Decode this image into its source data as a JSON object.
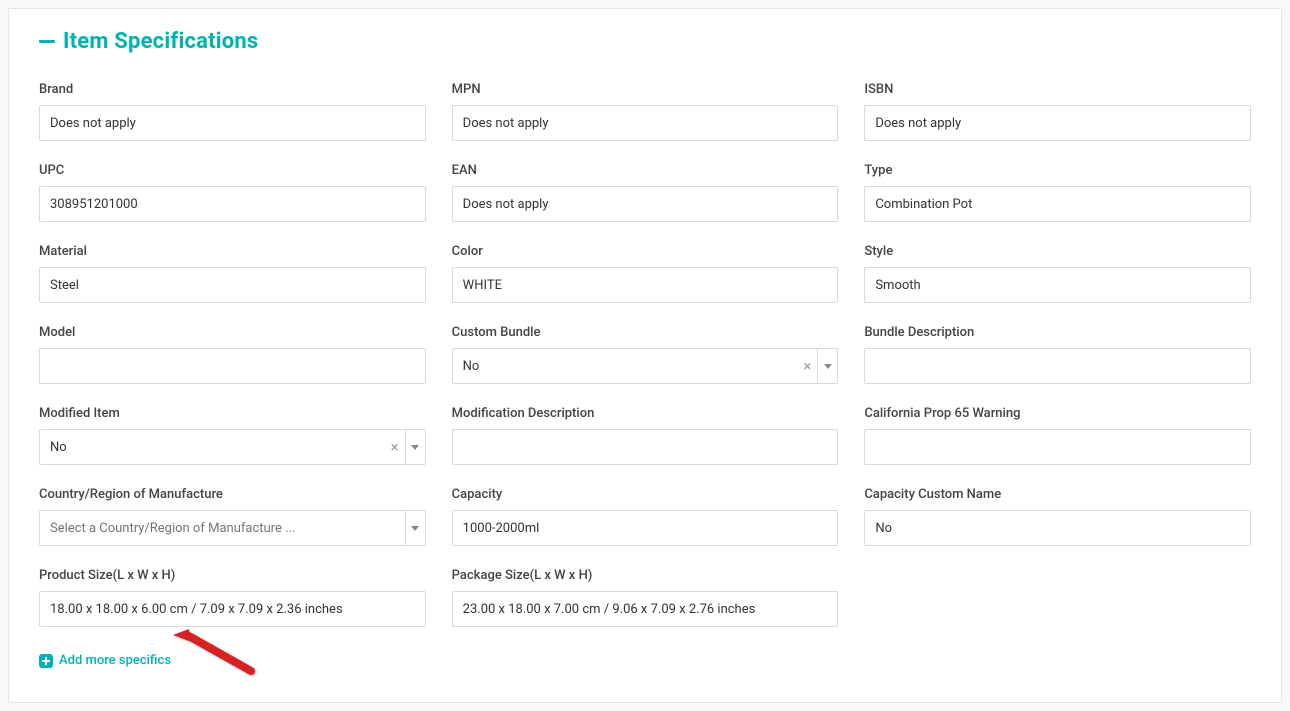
{
  "section_title": "Item Specifications",
  "fields": {
    "brand": {
      "label": "Brand",
      "value": "Does not apply"
    },
    "mpn": {
      "label": "MPN",
      "value": "Does not apply"
    },
    "isbn": {
      "label": "ISBN",
      "value": "Does not apply"
    },
    "upc": {
      "label": "UPC",
      "value": "308951201000"
    },
    "ean": {
      "label": "EAN",
      "value": "Does not apply"
    },
    "type": {
      "label": "Type",
      "value": "Combination Pot"
    },
    "material": {
      "label": "Material",
      "value": "Steel"
    },
    "color": {
      "label": "Color",
      "value": "WHITE"
    },
    "style": {
      "label": "Style",
      "value": "Smooth"
    },
    "model": {
      "label": "Model",
      "value": ""
    },
    "custom_bundle": {
      "label": "Custom Bundle",
      "value": "No"
    },
    "bundle_description": {
      "label": "Bundle Description",
      "value": ""
    },
    "modified_item": {
      "label": "Modified Item",
      "value": "No"
    },
    "modification_desc": {
      "label": "Modification Description",
      "value": ""
    },
    "prop65": {
      "label": "California Prop 65 Warning",
      "value": ""
    },
    "country": {
      "label": "Country/Region of Manufacture",
      "placeholder": "Select a Country/Region of Manufacture ..."
    },
    "capacity": {
      "label": "Capacity",
      "value": "1000-2000ml"
    },
    "capacity_custom_name": {
      "label": "Capacity Custom Name",
      "value": "No"
    },
    "product_size": {
      "label": "Product Size(L x W x H)",
      "value": "18.00 x 18.00 x 6.00 cm / 7.09 x 7.09 x 2.36 inches"
    },
    "package_size": {
      "label": "Package Size(L x W x H)",
      "value": "23.00 x 18.00 x 7.00 cm / 9.06 x 7.09 x 2.76 inches"
    }
  },
  "add_more_label": "Add more specifics"
}
